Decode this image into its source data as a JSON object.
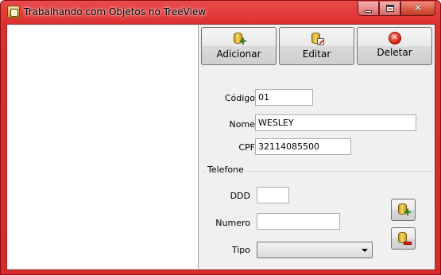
{
  "window": {
    "title": "Trabalhando com Objetos no TreeView",
    "caption_buttons": {
      "minimize": "minimize",
      "maximize": "maximize",
      "close": "✕"
    }
  },
  "toolbar": {
    "add_label": "Adicionar",
    "edit_label": "Editar",
    "delete_label": "Deletar"
  },
  "form": {
    "codigo_label": "Código",
    "codigo_value": "01",
    "nome_label": "Nome",
    "nome_value": "WESLEY",
    "cpf_label": "CPF",
    "cpf_value": "32114085500"
  },
  "telefone": {
    "group_title": "Telefone",
    "ddd_label": "DDD",
    "ddd_value": "",
    "numero_label": "Numero",
    "numero_value": "",
    "tipo_label": "Tipo",
    "tipo_value": ""
  },
  "icons": {
    "app": "app-icon",
    "add": "database-add-icon",
    "edit": "database-edit-icon",
    "delete": "delete-icon",
    "phone_add": "database-add-icon",
    "phone_remove": "database-remove-icon"
  },
  "colors": {
    "titlebar": "#dd2f2f",
    "client_bg": "#f0f0f0",
    "tree_bg": "#ffffff"
  }
}
